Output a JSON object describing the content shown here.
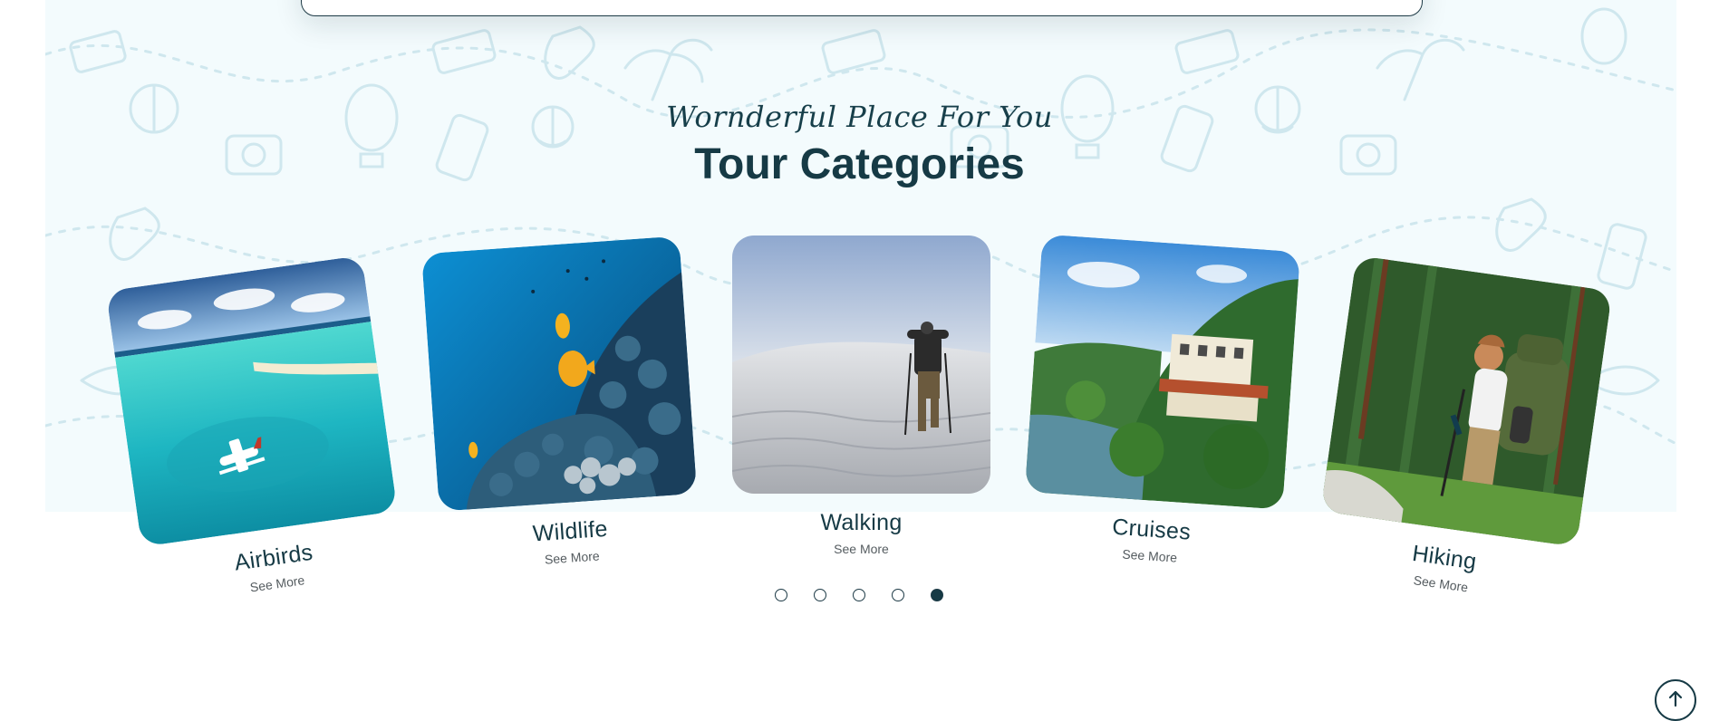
{
  "section": {
    "subtitle": "Wornderful Place For You",
    "title": "Tour Categories"
  },
  "categories": [
    {
      "name": "Airbirds",
      "link": "See More",
      "image": "seaplane-over-lagoon"
    },
    {
      "name": "Wildlife",
      "link": "See More",
      "image": "coral-reef-fish"
    },
    {
      "name": "Walking",
      "link": "See More",
      "image": "hiker-on-sand-dunes"
    },
    {
      "name": "Cruises",
      "link": "See More",
      "image": "lakeside-resort"
    },
    {
      "name": "Hiking",
      "link": "See More",
      "image": "backpacker-in-forest"
    }
  ],
  "carousel": {
    "pages": 5,
    "active_index": 5
  },
  "scroll_top": {
    "icon": "arrow-up-icon"
  },
  "colors": {
    "primary": "#163a45",
    "pattern_bg": "#f3fbfd",
    "pattern_icons": "#cfe7ee"
  }
}
